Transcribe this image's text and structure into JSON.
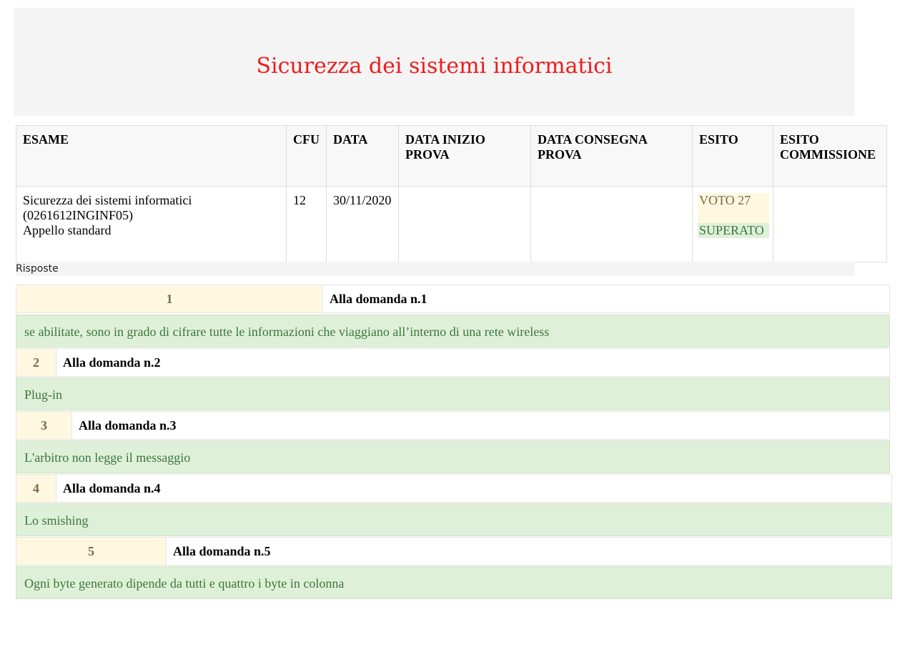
{
  "title": "Sicurezza dei sistemi informatici",
  "table": {
    "headers": {
      "esame": "ESAME",
      "cfu": "CFU",
      "data": "DATA",
      "data_inizio": "DATA INIZIO PROVA",
      "data_consegna": "DATA CONSEGNA PROVA",
      "esito": "ESITO",
      "esito_commissione": "ESITO COMMISSIONE"
    },
    "row": {
      "esame_name": "Sicurezza dei sistemi informatici",
      "esame_code": "(0261612INGINF05)",
      "esame_type": "Appello standard",
      "cfu": "12",
      "data": "30/11/2020",
      "data_inizio": "",
      "data_consegna": "",
      "esito_voto": "VOTO 27",
      "esito_stato": "SUPERATO",
      "esito_commissione": ""
    }
  },
  "risposte_label": "Risposte",
  "answers": [
    {
      "number": "1",
      "label": "Alla domanda n.1",
      "answer": "se abilitate, sono in grado di cifrare tutte le informazioni che viaggiano all’interno di una rete wireless"
    },
    {
      "number": "2",
      "label": "Alla domanda n.2",
      "answer": "Plug-in"
    },
    {
      "number": "3",
      "label": "Alla domanda n.3",
      "answer": "L'arbitro non legge il messaggio"
    },
    {
      "number": "4",
      "label": "Alla domanda n.4",
      "answer": "Lo smishing"
    },
    {
      "number": "5",
      "label": "Alla domanda n.5",
      "answer": "Ogni byte generato dipende da tutti e quattro i byte in colonna"
    }
  ],
  "colors": {
    "title": "#ee1c1c",
    "number_bg": "#fff8e1",
    "answer_bg": "#dff0d8",
    "answer_text": "#3c763d"
  }
}
